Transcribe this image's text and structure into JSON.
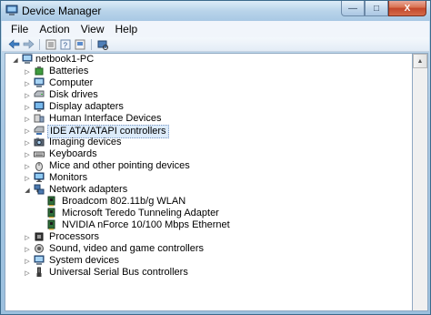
{
  "window": {
    "title": "Device Manager",
    "controls": {
      "minimize": "—",
      "maximize": "□",
      "close": "X"
    }
  },
  "menu": [
    "File",
    "Action",
    "View",
    "Help"
  ],
  "toolbar": [
    "back-arrow-icon",
    "forward-arrow-icon",
    "properties-icon",
    "help-icon",
    "show-hidden-icon",
    "scan-hardware-icon"
  ],
  "tree": {
    "root": "netbook1-PC",
    "categories": [
      {
        "label": "Batteries",
        "icon": "battery-icon"
      },
      {
        "label": "Computer",
        "icon": "computer-icon"
      },
      {
        "label": "Disk drives",
        "icon": "disk-drive-icon"
      },
      {
        "label": "Display adapters",
        "icon": "display-adapter-icon"
      },
      {
        "label": "Human Interface Devices",
        "icon": "hid-icon"
      },
      {
        "label": "IDE ATA/ATAPI controllers",
        "icon": "ide-controller-icon",
        "selected": true
      },
      {
        "label": "Imaging devices",
        "icon": "camera-icon"
      },
      {
        "label": "Keyboards",
        "icon": "keyboard-icon"
      },
      {
        "label": "Mice and other pointing devices",
        "icon": "mouse-icon"
      },
      {
        "label": "Monitors",
        "icon": "monitor-icon"
      },
      {
        "label": "Network adapters",
        "icon": "network-adapter-icon",
        "expanded": true
      },
      {
        "label": "Processors",
        "icon": "processor-icon"
      },
      {
        "label": "Sound, video and game controllers",
        "icon": "sound-icon"
      },
      {
        "label": "System devices",
        "icon": "system-device-icon"
      },
      {
        "label": "Universal Serial Bus controllers",
        "icon": "usb-icon"
      }
    ],
    "network_children": [
      "Broadcom 802.11b/g WLAN",
      "Microsoft Teredo Tunneling Adapter",
      "NVIDIA nForce 10/100 Mbps Ethernet"
    ]
  },
  "colors": {
    "selection": "#dcebfa",
    "frame": "#9bc0de",
    "close_button": "#c3472b"
  }
}
